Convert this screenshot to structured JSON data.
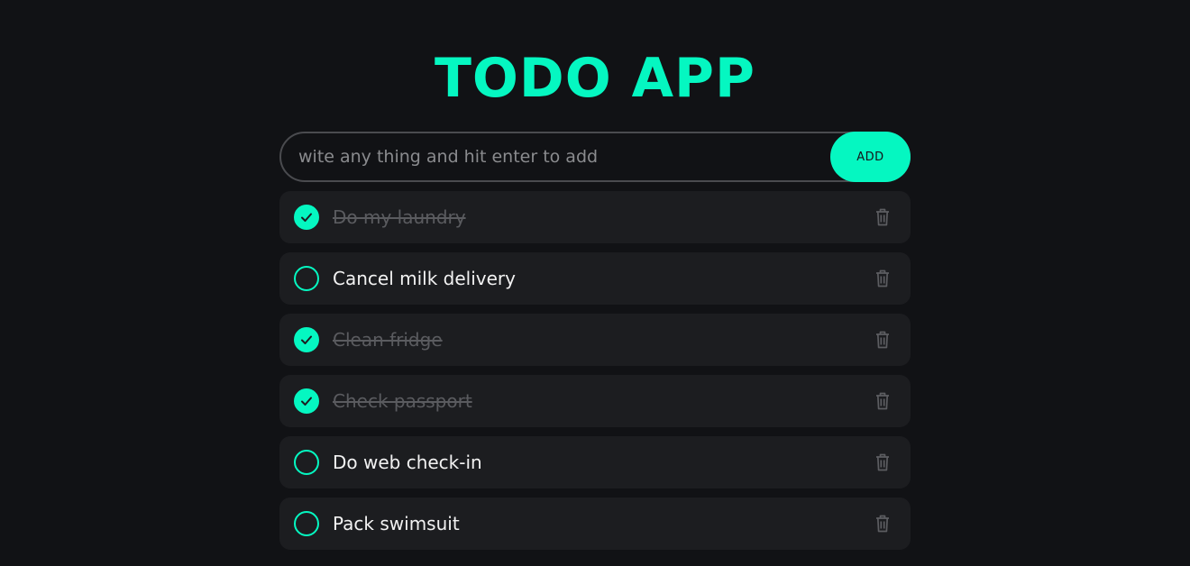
{
  "app": {
    "title": "TODO APP"
  },
  "input": {
    "placeholder": "wite any thing and hit enter to add",
    "value": "",
    "add_label": "ADD"
  },
  "todos": [
    {
      "text": "Do my laundry",
      "done": true
    },
    {
      "text": "Cancel milk delivery",
      "done": false
    },
    {
      "text": "Clean fridge",
      "done": true
    },
    {
      "text": "Check passport",
      "done": true
    },
    {
      "text": "Do web check-in",
      "done": false
    },
    {
      "text": "Pack swimsuit",
      "done": false
    }
  ],
  "icons": {
    "check": "check-icon",
    "delete": "trash-icon"
  },
  "colors": {
    "accent": "#05f7c1",
    "background": "#111215",
    "item_background": "#1c1d20",
    "done_text": "#5a5b5f"
  }
}
